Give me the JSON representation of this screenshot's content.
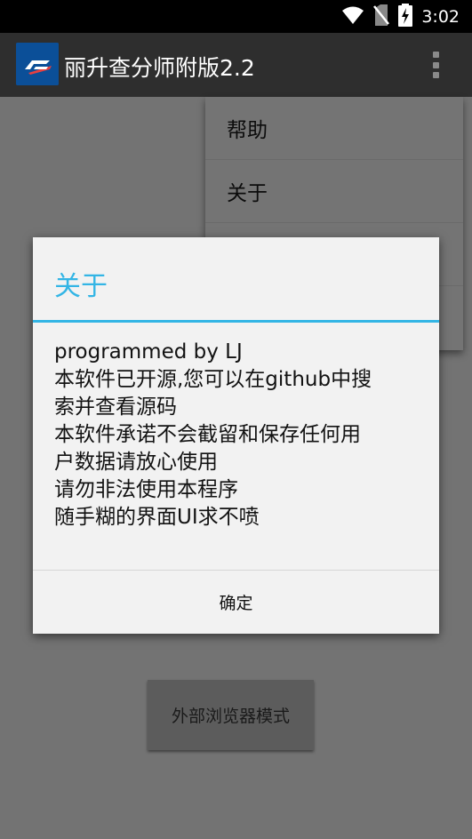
{
  "status_bar": {
    "time": "3:02",
    "icons": [
      "wifi-icon",
      "no-sim-icon",
      "battery-charging-icon"
    ]
  },
  "app_bar": {
    "title": "丽升查分师附版2.2",
    "logo": "app-logo-icon",
    "overflow_icon": "more-vert-icon"
  },
  "popup_menu": {
    "items": [
      {
        "label": "帮助"
      },
      {
        "label": "关于"
      },
      {
        "label": ""
      },
      {
        "label": ""
      }
    ]
  },
  "main": {
    "browser_mode_button_label": "外部浏览器模式"
  },
  "dialog": {
    "title": "关于",
    "lines": [
      "programmed by LJ",
      "本软件已开源,您可以在github中搜",
      "索并查看源码",
      "本软件承诺不会截留和保存任何用",
      "户数据请放心使用",
      "请勿非法使用本程序",
      "随手糊的界面UI求不喷"
    ],
    "ok_label": "确定"
  },
  "colors": {
    "accent": "#33b5e5",
    "status_bar": "#000000",
    "app_bar": "#2e2e2e",
    "logo_bg": "#0b4f98"
  }
}
